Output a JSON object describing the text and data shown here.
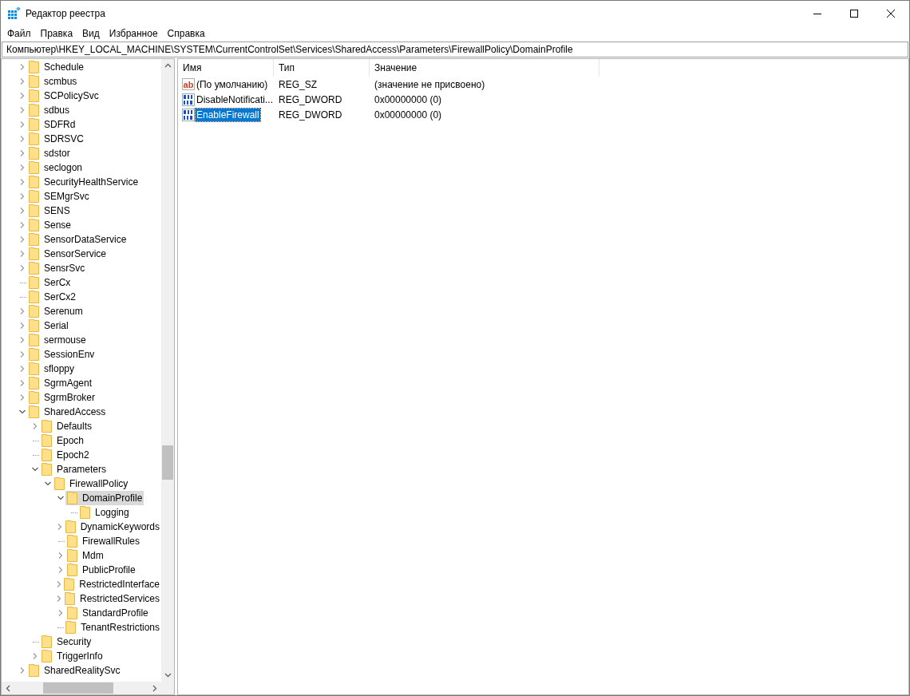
{
  "window": {
    "title": "Редактор реестра"
  },
  "menu": [
    "Файл",
    "Правка",
    "Вид",
    "Избранное",
    "Справка"
  ],
  "address": "Компьютер\\HKEY_LOCAL_MACHINE\\SYSTEM\\CurrentControlSet\\Services\\SharedAccess\\Parameters\\FirewallPolicy\\DomainProfile",
  "tree": [
    {
      "label": "Schedule",
      "kind": "folder",
      "expanded": false,
      "selected": false
    },
    {
      "label": "scmbus",
      "kind": "folder",
      "expanded": false,
      "selected": false
    },
    {
      "label": "SCPolicySvc",
      "kind": "folder",
      "expanded": false,
      "selected": false
    },
    {
      "label": "sdbus",
      "kind": "folder",
      "expanded": false,
      "selected": false
    },
    {
      "label": "SDFRd",
      "kind": "folder",
      "expanded": false,
      "selected": false
    },
    {
      "label": "SDRSVC",
      "kind": "folder",
      "expanded": false,
      "selected": false
    },
    {
      "label": "sdstor",
      "kind": "folder",
      "expanded": false,
      "selected": false
    },
    {
      "label": "seclogon",
      "kind": "folder",
      "expanded": false,
      "selected": false
    },
    {
      "label": "SecurityHealthService",
      "kind": "folder",
      "expanded": false,
      "selected": false
    },
    {
      "label": "SEMgrSvc",
      "kind": "folder",
      "expanded": false,
      "selected": false
    },
    {
      "label": "SENS",
      "kind": "folder",
      "expanded": false,
      "selected": false
    },
    {
      "label": "Sense",
      "kind": "folder",
      "expanded": false,
      "selected": false
    },
    {
      "label": "SensorDataService",
      "kind": "folder",
      "expanded": false,
      "selected": false
    },
    {
      "label": "SensorService",
      "kind": "folder",
      "expanded": false,
      "selected": false
    },
    {
      "label": "SensrSvc",
      "kind": "folder",
      "expanded": false,
      "selected": false
    },
    {
      "label": "SerCx",
      "kind": "leaf",
      "selected": false
    },
    {
      "label": "SerCx2",
      "kind": "leaf",
      "selected": false
    },
    {
      "label": "Serenum",
      "kind": "folder",
      "expanded": false,
      "selected": false
    },
    {
      "label": "Serial",
      "kind": "folder",
      "expanded": false,
      "selected": false
    },
    {
      "label": "sermouse",
      "kind": "folder",
      "expanded": false,
      "selected": false
    },
    {
      "label": "SessionEnv",
      "kind": "folder",
      "expanded": false,
      "selected": false
    },
    {
      "label": "sfloppy",
      "kind": "folder",
      "expanded": false,
      "selected": false
    },
    {
      "label": "SgrmAgent",
      "kind": "folder",
      "expanded": false,
      "selected": false
    },
    {
      "label": "SgrmBroker",
      "kind": "folder",
      "expanded": false,
      "selected": false
    },
    {
      "label": "SharedAccess",
      "kind": "folder",
      "expanded": true,
      "selected": false,
      "children": [
        {
          "label": "Defaults",
          "kind": "folder",
          "expanded": false,
          "selected": false
        },
        {
          "label": "Epoch",
          "kind": "leaf",
          "selected": false
        },
        {
          "label": "Epoch2",
          "kind": "leaf",
          "selected": false
        },
        {
          "label": "Parameters",
          "kind": "folder",
          "expanded": true,
          "selected": false,
          "children": [
            {
              "label": "FirewallPolicy",
              "kind": "folder",
              "expanded": true,
              "selected": false,
              "children": [
                {
                  "label": "DomainProfile",
                  "kind": "folder",
                  "expanded": true,
                  "selected": true,
                  "children": [
                    {
                      "label": "Logging",
                      "kind": "leaf",
                      "selected": false
                    }
                  ]
                },
                {
                  "label": "DynamicKeywords",
                  "kind": "folder",
                  "expanded": false,
                  "selected": false
                },
                {
                  "label": "FirewallRules",
                  "kind": "leaf",
                  "selected": false
                },
                {
                  "label": "Mdm",
                  "kind": "folder",
                  "expanded": false,
                  "selected": false
                },
                {
                  "label": "PublicProfile",
                  "kind": "folder",
                  "expanded": false,
                  "selected": false
                },
                {
                  "label": "RestrictedInterface",
                  "kind": "folder",
                  "expanded": false,
                  "selected": false
                },
                {
                  "label": "RestrictedServices",
                  "kind": "folder",
                  "expanded": false,
                  "selected": false
                },
                {
                  "label": "StandardProfile",
                  "kind": "folder",
                  "expanded": false,
                  "selected": false
                },
                {
                  "label": "TenantRestrictions",
                  "kind": "leaf",
                  "selected": false
                }
              ]
            }
          ]
        },
        {
          "label": "Security",
          "kind": "leaf",
          "selected": false
        },
        {
          "label": "TriggerInfo",
          "kind": "folder",
          "expanded": false,
          "selected": false
        }
      ]
    },
    {
      "label": "SharedRealitySvc",
      "kind": "folder",
      "expanded": false,
      "selected": false
    }
  ],
  "values": {
    "columns": [
      "Имя",
      "Тип",
      "Значение"
    ],
    "rows": [
      {
        "kind": "string",
        "icon_text": "ab",
        "name": "(По умолчанию)",
        "type": "REG_SZ",
        "data": "(значение не присвоено)",
        "selected": false
      },
      {
        "kind": "binary",
        "name": "DisableNotificati...",
        "type": "REG_DWORD",
        "data": "0x00000000 (0)",
        "selected": false
      },
      {
        "kind": "binary",
        "name": "EnableFirewall",
        "type": "REG_DWORD",
        "data": "0x00000000 (0)",
        "selected": true
      }
    ]
  }
}
